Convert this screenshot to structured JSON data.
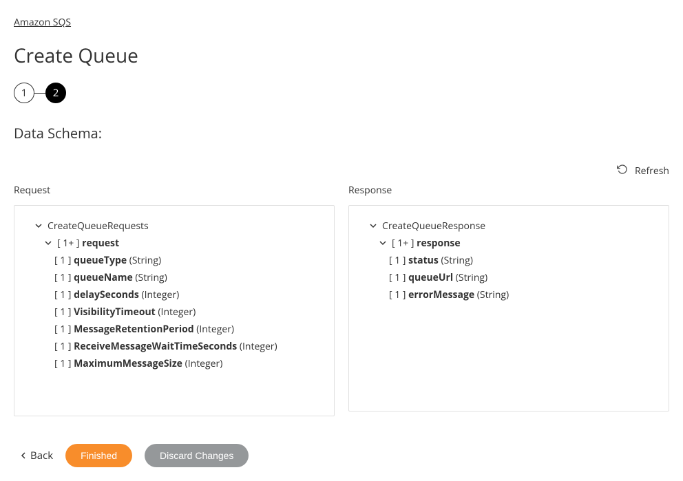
{
  "breadcrumb": "Amazon SQS",
  "pageTitle": "Create Queue",
  "stepper": {
    "step1": "1",
    "step2": "2"
  },
  "sectionTitle": "Data Schema:",
  "refresh": "Refresh",
  "columns": {
    "request": {
      "label": "Request",
      "root": "CreateQueueRequests",
      "child": {
        "cardinality": "[ 1+ ]",
        "name": "request"
      },
      "fields": [
        {
          "cardinality": "[ 1 ]",
          "name": "queueType",
          "type": "(String)"
        },
        {
          "cardinality": "[ 1 ]",
          "name": "queueName",
          "type": "(String)"
        },
        {
          "cardinality": "[ 1 ]",
          "name": "delaySeconds",
          "type": "(Integer)"
        },
        {
          "cardinality": "[ 1 ]",
          "name": "VisibilityTimeout",
          "type": "(Integer)"
        },
        {
          "cardinality": "[ 1 ]",
          "name": "MessageRetentionPeriod",
          "type": "(Integer)"
        },
        {
          "cardinality": "[ 1 ]",
          "name": "ReceiveMessageWaitTimeSeconds",
          "type": "(Integer)"
        },
        {
          "cardinality": "[ 1 ]",
          "name": "MaximumMessageSize",
          "type": "(Integer)"
        }
      ]
    },
    "response": {
      "label": "Response",
      "root": "CreateQueueResponse",
      "child": {
        "cardinality": "[ 1+ ]",
        "name": "response"
      },
      "fields": [
        {
          "cardinality": "[ 1 ]",
          "name": "status",
          "type": "(String)"
        },
        {
          "cardinality": "[ 1 ]",
          "name": "queueUrl",
          "type": "(String)"
        },
        {
          "cardinality": "[ 1 ]",
          "name": "errorMessage",
          "type": "(String)"
        }
      ]
    }
  },
  "footer": {
    "back": "Back",
    "finished": "Finished",
    "discard": "Discard Changes"
  }
}
